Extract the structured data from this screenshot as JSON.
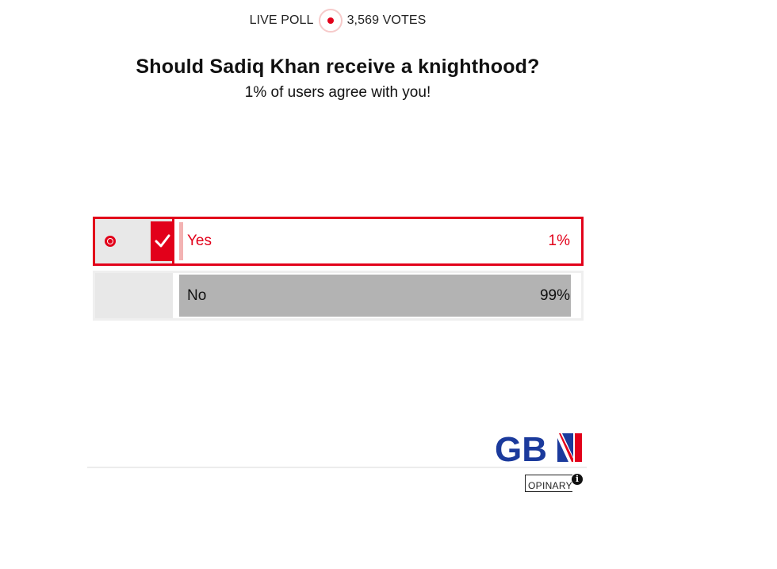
{
  "header": {
    "live_label": "LIVE POLL",
    "votes_label": "3,569 VOTES",
    "live_color": "#e2001a"
  },
  "poll": {
    "question": "Should Sadiq Khan receive a knighthood?",
    "result_message": "1% of users agree with you!",
    "options": [
      {
        "label": "Yes",
        "percent_label": "1%",
        "percent": 1,
        "selected": true
      },
      {
        "label": "No",
        "percent_label": "99%",
        "percent": 99,
        "selected": false
      }
    ]
  },
  "branding": {
    "logo_text": "GBN",
    "powered_by": "OPINARY",
    "info_icon": "info-icon",
    "accent_color": "#e2001a",
    "logo_color": "#1b3a9c"
  }
}
